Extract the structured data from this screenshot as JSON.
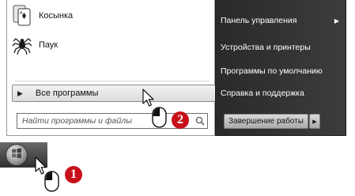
{
  "start_menu": {
    "pinned_programs": [
      {
        "label": "Косынка",
        "icon": "solitaire-icon"
      },
      {
        "label": "Паук",
        "icon": "spider-icon"
      }
    ],
    "all_programs": {
      "label": "Все программы",
      "icon": "arrow-right-icon"
    },
    "search": {
      "placeholder": "Найти программы и файлы",
      "value": "",
      "icon": "search-icon"
    },
    "right_items": [
      {
        "label": "Панель управления",
        "has_submenu": true
      },
      {
        "label": "Устройства и принтеры"
      },
      {
        "label": "Программы по умолчанию"
      },
      {
        "label": "Справка и поддержка"
      }
    ],
    "shutdown": {
      "label": "Завершение работы",
      "arrow_icon": "arrow-right-icon"
    }
  },
  "taskbar": {
    "start_button_icon": "windows-orb-icon"
  },
  "annotations": [
    {
      "number": "1",
      "color": "#c8101a"
    },
    {
      "number": "2",
      "color": "#c8101a"
    }
  ],
  "colors": {
    "right_pane": "#333333",
    "badge": "#c8101a"
  }
}
